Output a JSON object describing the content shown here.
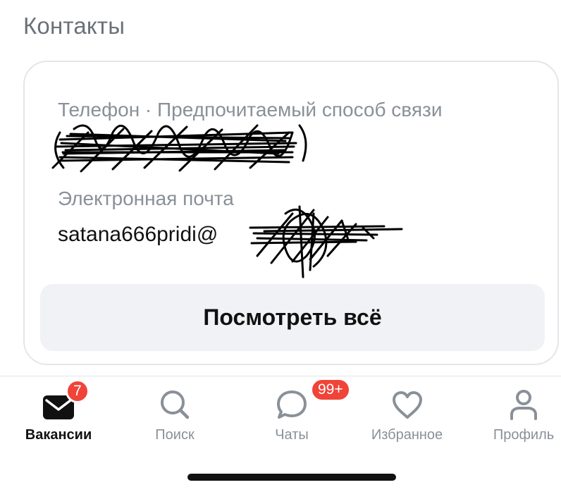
{
  "contacts": {
    "title": "Контакты",
    "phone_label": "Телефон · Предпочитаемый способ связи",
    "email_label": "Электронная почта",
    "email_value": "satana666pridi@",
    "view_all_label": "Посмотреть всё"
  },
  "tabbar": {
    "tabs": [
      {
        "label": "Вакансии",
        "icon": "envelope-icon",
        "badge": "7",
        "active": true
      },
      {
        "label": "Поиск",
        "icon": "search-icon"
      },
      {
        "label": "Чаты",
        "icon": "chat-bubble-icon",
        "badge": "99+"
      },
      {
        "label": "Избранное",
        "icon": "heart-icon"
      },
      {
        "label": "Профиль",
        "icon": "person-icon"
      }
    ]
  },
  "colors": {
    "badge": "#f04438",
    "inactive": "#8a9098",
    "active": "#111111",
    "button_bg": "#f0f2f6"
  }
}
